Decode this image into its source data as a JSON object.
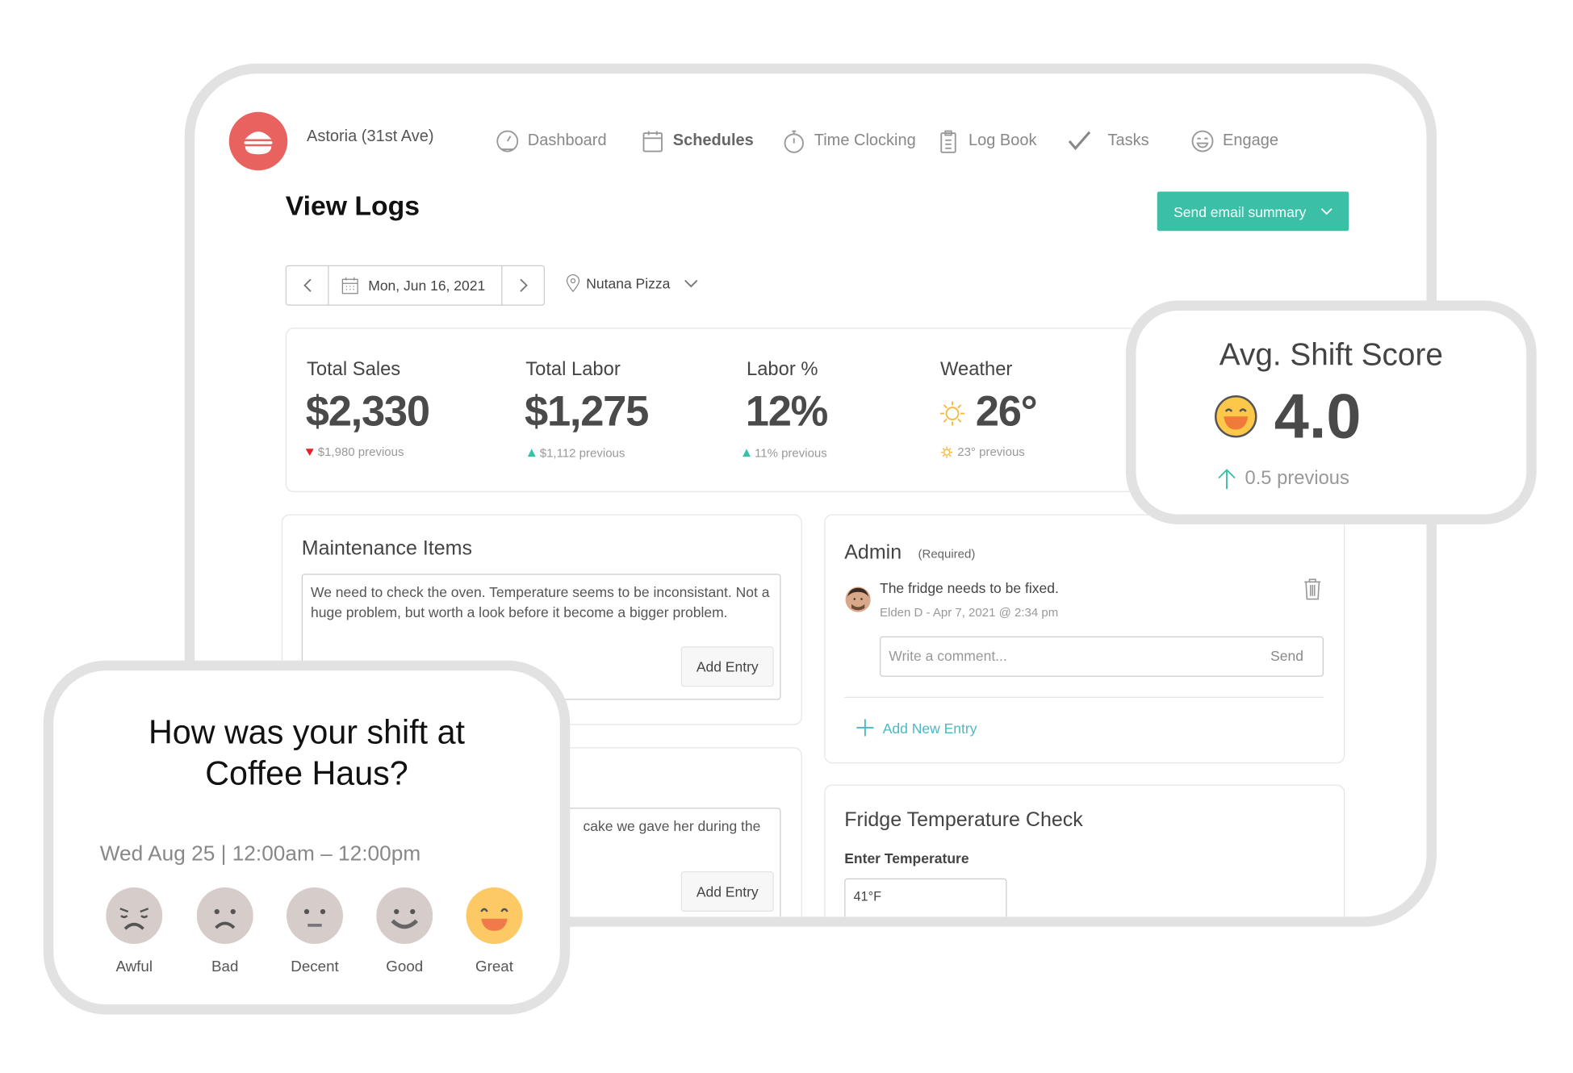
{
  "header": {
    "location": "Astoria (31st Ave)",
    "logo_color": "#e8635f",
    "nav": [
      {
        "label": "Dashboard",
        "icon": "speedometer-icon"
      },
      {
        "label": "Schedules",
        "icon": "calendar-icon"
      },
      {
        "label": "Time Clocking",
        "icon": "stopwatch-icon"
      },
      {
        "label": "Log Book",
        "icon": "clipboard-icon"
      },
      {
        "label": "Tasks",
        "icon": "check-icon"
      },
      {
        "label": "Engage",
        "icon": "smiley-icon"
      }
    ]
  },
  "page": {
    "title": "View Logs",
    "send_email_label": "Send email summary",
    "accent": "#3bbfa7"
  },
  "filters": {
    "date": "Mon, Jun 16, 2021",
    "location": "Nutana Pizza"
  },
  "stats": [
    {
      "label": "Total Sales",
      "value": "$2,330",
      "previous": "$1,980 previous",
      "trend": "down"
    },
    {
      "label": "Total Labor",
      "value": "$1,275",
      "previous": "$1,112 previous",
      "trend": "up"
    },
    {
      "label": "Labor %",
      "value": "12%",
      "previous": "11% previous",
      "trend": "up"
    },
    {
      "label": "Weather",
      "value": "26°",
      "previous": "23° previous",
      "trend": "sun"
    }
  ],
  "score": {
    "title": "Avg. Shift Score",
    "value": "4.0",
    "previous": "0.5 previous"
  },
  "maintenance": {
    "title": "Maintenance Items",
    "text": "We need to check the oven. Temperature seems to be inconsistant. Not a huge problem, but worth a look before it become a bigger problem.",
    "add_label": "Add Entry"
  },
  "second": {
    "text": "cake we gave her during the",
    "add_label": "Add Entry"
  },
  "admin": {
    "title": "Admin",
    "required": "(Required)",
    "entry": "The fridge needs to be fixed.",
    "meta": "Elden D - Apr 7, 2021 @ 2:34 pm",
    "comment_placeholder": "Write a comment...",
    "send": "Send",
    "add_new": "Add New Entry"
  },
  "fridge": {
    "title": "Fridge Temperature Check",
    "label": "Enter Temperature",
    "value": "41°F"
  },
  "survey": {
    "title_line1": "How was your shift at",
    "title_line2": "Coffee Haus?",
    "date": "Wed Aug 25 | 12:00am – 12:00pm",
    "options": [
      "Awful",
      "Bad",
      "Decent",
      "Good",
      "Great"
    ],
    "selected": "Great"
  }
}
